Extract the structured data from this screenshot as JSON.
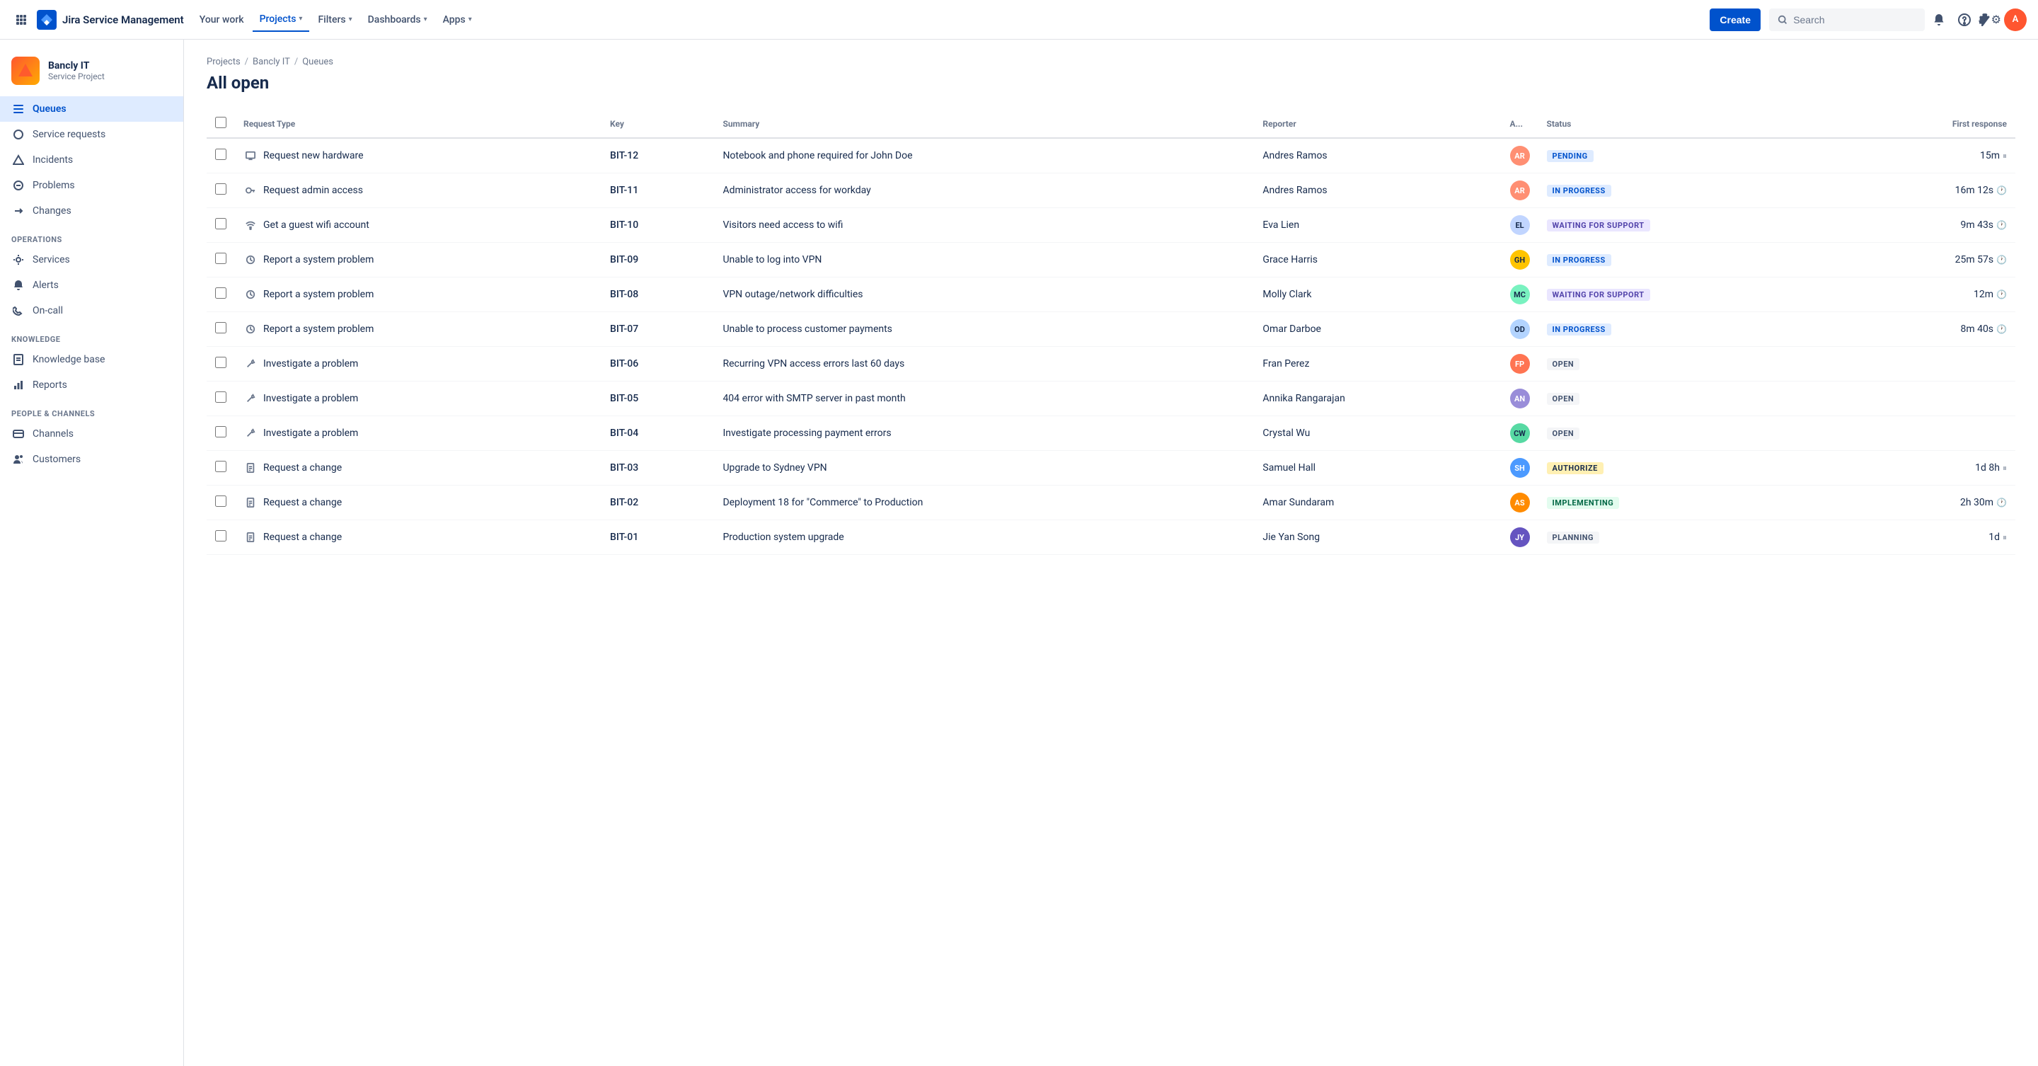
{
  "app": {
    "name": "Jira Service Management"
  },
  "topnav": {
    "your_work": "Your work",
    "projects": "Projects",
    "filters": "Filters",
    "dashboards": "Dashboards",
    "apps": "Apps",
    "create": "Create",
    "search_placeholder": "Search"
  },
  "sidebar": {
    "project_name": "Bancly IT",
    "project_type": "Service Project",
    "items": [
      {
        "id": "queues",
        "label": "Queues",
        "icon": "☰",
        "active": true
      },
      {
        "id": "service-requests",
        "label": "Service requests",
        "icon": "◯",
        "active": false
      },
      {
        "id": "incidents",
        "label": "Incidents",
        "icon": "△",
        "active": false
      },
      {
        "id": "problems",
        "label": "Problems",
        "icon": "⊘",
        "active": false
      },
      {
        "id": "changes",
        "label": "Changes",
        "icon": "↻",
        "active": false
      }
    ],
    "operations_label": "OPERATIONS",
    "operations_items": [
      {
        "id": "services",
        "label": "Services",
        "icon": "⤢"
      },
      {
        "id": "alerts",
        "label": "Alerts",
        "icon": "🔔"
      },
      {
        "id": "on-call",
        "label": "On-call",
        "icon": "📞"
      }
    ],
    "knowledge_label": "KNOWLEDGE",
    "knowledge_items": [
      {
        "id": "knowledge-base",
        "label": "Knowledge base",
        "icon": "📄"
      },
      {
        "id": "reports",
        "label": "Reports",
        "icon": "📊"
      }
    ],
    "people_label": "PEOPLE & CHANNELS",
    "people_items": [
      {
        "id": "channels",
        "label": "Channels",
        "icon": "🖥"
      },
      {
        "id": "customers",
        "label": "Customers",
        "icon": "👥"
      }
    ]
  },
  "breadcrumb": [
    "Projects",
    "Bancly IT",
    "Queues"
  ],
  "page_title": "All open",
  "table": {
    "columns": [
      "",
      "Request Type",
      "Key",
      "Summary",
      "Reporter",
      "A...",
      "Status",
      "First response"
    ],
    "rows": [
      {
        "req_type": "Request new hardware",
        "req_icon": "monitor",
        "key": "BIT-12",
        "summary": "Notebook and phone required for John Doe",
        "reporter": "Andres Ramos",
        "avatar_color": "#FF8F73",
        "avatar_initials": "AR",
        "status": "PENDING",
        "status_class": "badge-pending",
        "first_response": "15m",
        "response_icon": "pause"
      },
      {
        "req_type": "Request admin access",
        "req_icon": "key",
        "key": "BIT-11",
        "summary": "Administrator access for workday",
        "reporter": "Andres Ramos",
        "avatar_color": "#FF8F73",
        "avatar_initials": "AR",
        "status": "IN PROGRESS",
        "status_class": "badge-inprogress",
        "first_response": "16m 12s",
        "response_icon": "clock"
      },
      {
        "req_type": "Get a guest wifi account",
        "req_icon": "wifi",
        "key": "BIT-10",
        "summary": "Visitors need access to wifi",
        "reporter": "Eva Lien",
        "avatar_color": "#C1D5FF",
        "avatar_initials": "EL",
        "status": "WAITING FOR SUPPORT",
        "status_class": "badge-waiting",
        "first_response": "9m 43s",
        "response_icon": "clock"
      },
      {
        "req_type": "Report a system problem",
        "req_icon": "clock",
        "key": "BIT-09",
        "summary": "Unable to log into VPN",
        "reporter": "Grace Harris",
        "avatar_color": "#FFC400",
        "avatar_initials": "GH",
        "status": "IN PROGRESS",
        "status_class": "badge-inprogress",
        "first_response": "25m 57s",
        "response_icon": "clock"
      },
      {
        "req_type": "Report a system problem",
        "req_icon": "clock",
        "key": "BIT-08",
        "summary": "VPN outage/network difficulties",
        "reporter": "Molly Clark",
        "avatar_color": "#79F2C0",
        "avatar_initials": "MC",
        "status": "WAITING FOR SUPPORT",
        "status_class": "badge-waiting",
        "first_response": "12m",
        "response_icon": "clock"
      },
      {
        "req_type": "Report a system problem",
        "req_icon": "clock",
        "key": "BIT-07",
        "summary": "Unable to process customer payments",
        "reporter": "Omar Darboe",
        "avatar_color": "#B3D4FF",
        "avatar_initials": "OD",
        "status": "IN PROGRESS",
        "status_class": "badge-inprogress",
        "first_response": "8m 40s",
        "response_icon": "clock"
      },
      {
        "req_type": "Investigate a problem",
        "req_icon": "wrench",
        "key": "BIT-06",
        "summary": "Recurring VPN access errors last 60 days",
        "reporter": "Fran Perez",
        "avatar_color": "#FF7452",
        "avatar_initials": "FP",
        "status": "OPEN",
        "status_class": "badge-open",
        "first_response": "",
        "response_icon": ""
      },
      {
        "req_type": "Investigate a problem",
        "req_icon": "wrench",
        "key": "BIT-05",
        "summary": "404 error with SMTP server in past month",
        "reporter": "Annika Rangarajan",
        "avatar_color": "#998DD9",
        "avatar_initials": "AN",
        "status": "OPEN",
        "status_class": "badge-open",
        "first_response": "",
        "response_icon": ""
      },
      {
        "req_type": "Investigate a problem",
        "req_icon": "wrench",
        "key": "BIT-04",
        "summary": "Investigate processing payment errors",
        "reporter": "Crystal Wu",
        "avatar_color": "#57D9A3",
        "avatar_initials": "CW",
        "status": "OPEN",
        "status_class": "badge-open",
        "first_response": "",
        "response_icon": ""
      },
      {
        "req_type": "Request a change",
        "req_icon": "doc",
        "key": "BIT-03",
        "summary": "Upgrade to Sydney VPN",
        "reporter": "Samuel Hall",
        "avatar_color": "#4C9AFF",
        "avatar_initials": "SH",
        "status": "AUTHORIZE",
        "status_class": "badge-authorize",
        "first_response": "1d 8h",
        "response_icon": "pause"
      },
      {
        "req_type": "Request a change",
        "req_icon": "doc",
        "key": "BIT-02",
        "summary": "Deployment 18 for \"Commerce\" to Production",
        "reporter": "Amar Sundaram",
        "avatar_color": "#FF8B00",
        "avatar_initials": "AS",
        "status": "IMPLEMENTING",
        "status_class": "badge-implementing",
        "first_response": "2h 30m",
        "response_icon": "clock"
      },
      {
        "req_type": "Request a change",
        "req_icon": "doc",
        "key": "BIT-01",
        "summary": "Production system upgrade",
        "reporter": "Jie Yan Song",
        "avatar_color": "#6554C0",
        "avatar_initials": "JY",
        "status": "PLANNING",
        "status_class": "badge-planning",
        "first_response": "1d",
        "response_icon": "pause"
      }
    ]
  }
}
